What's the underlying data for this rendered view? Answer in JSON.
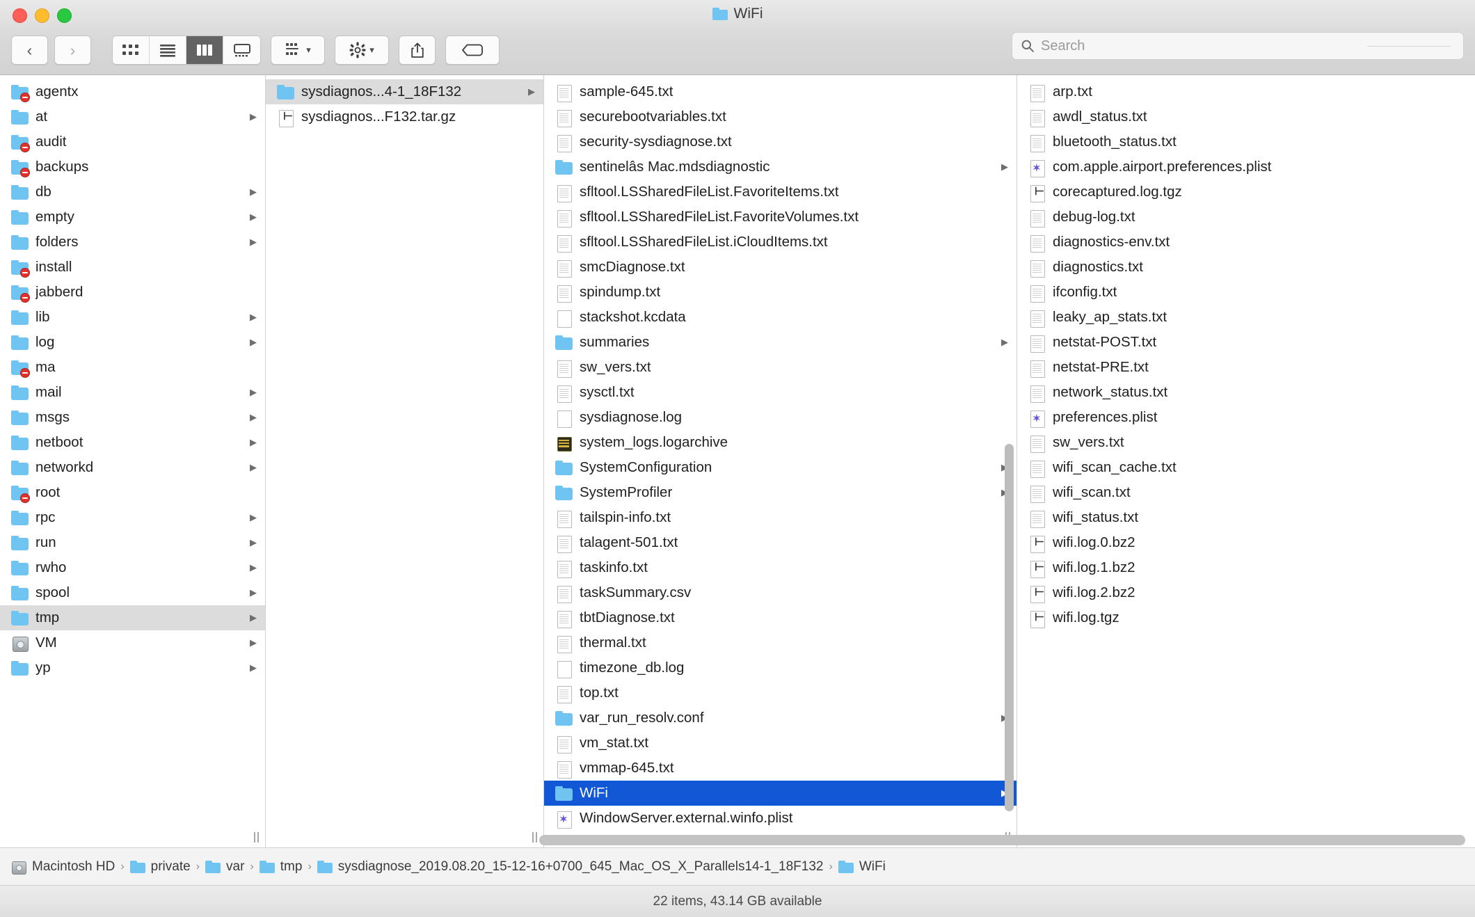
{
  "window": {
    "title": "WiFi",
    "title_icon": "folder-icon"
  },
  "toolbar": {
    "back_label": "‹",
    "forward_label": "›",
    "view_icons": [
      "icon-view-icon",
      "list-view-icon",
      "column-view-icon",
      "gallery-view-icon"
    ],
    "active_view": "column-view-icon",
    "group_label": "group-by-icon",
    "action_label": "gear-icon",
    "share_label": "share-icon",
    "tags_label": "tag-icon"
  },
  "search": {
    "placeholder": "Search",
    "value": ""
  },
  "columns": [
    {
      "name": "column-var",
      "items": [
        {
          "label": "agentx",
          "icon": "folder-icon",
          "badge": "no-access",
          "arrow": false
        },
        {
          "label": "at",
          "icon": "folder-icon",
          "arrow": true
        },
        {
          "label": "audit",
          "icon": "folder-icon",
          "badge": "no-access",
          "arrow": false
        },
        {
          "label": "backups",
          "icon": "folder-icon",
          "badge": "no-access",
          "arrow": false
        },
        {
          "label": "db",
          "icon": "folder-icon",
          "arrow": true
        },
        {
          "label": "empty",
          "icon": "folder-icon",
          "arrow": true
        },
        {
          "label": "folders",
          "icon": "folder-icon",
          "arrow": true
        },
        {
          "label": "install",
          "icon": "folder-icon",
          "badge": "no-access",
          "arrow": false
        },
        {
          "label": "jabberd",
          "icon": "folder-icon",
          "badge": "no-access",
          "arrow": false
        },
        {
          "label": "lib",
          "icon": "folder-icon",
          "arrow": true
        },
        {
          "label": "log",
          "icon": "folder-icon",
          "arrow": true
        },
        {
          "label": "ma",
          "icon": "folder-icon",
          "badge": "no-access",
          "arrow": false
        },
        {
          "label": "mail",
          "icon": "folder-icon",
          "arrow": true
        },
        {
          "label": "msgs",
          "icon": "folder-icon",
          "arrow": true
        },
        {
          "label": "netboot",
          "icon": "folder-icon",
          "arrow": true
        },
        {
          "label": "networkd",
          "icon": "folder-icon",
          "arrow": true
        },
        {
          "label": "root",
          "icon": "folder-icon",
          "badge": "no-access",
          "arrow": false
        },
        {
          "label": "rpc",
          "icon": "folder-icon",
          "arrow": true
        },
        {
          "label": "run",
          "icon": "folder-icon",
          "arrow": true
        },
        {
          "label": "rwho",
          "icon": "folder-icon",
          "arrow": true
        },
        {
          "label": "spool",
          "icon": "folder-icon",
          "arrow": true
        },
        {
          "label": "tmp",
          "icon": "folder-icon",
          "arrow": true,
          "selected": "gray"
        },
        {
          "label": "VM",
          "icon": "disk-icon",
          "arrow": true
        },
        {
          "label": "yp",
          "icon": "folder-icon",
          "arrow": true
        }
      ]
    },
    {
      "name": "column-tmp",
      "items": [
        {
          "label": "sysdiagnos...4-1_18F132",
          "icon": "folder-icon",
          "arrow": true,
          "selected": "gray"
        },
        {
          "label": "sysdiagnos...F132.tar.gz",
          "icon": "archive-icon",
          "arrow": false
        }
      ]
    },
    {
      "name": "column-sysdiagnose",
      "items": [
        {
          "label": "sample-645.txt",
          "icon": "text-document-icon",
          "arrow": false
        },
        {
          "label": "securebootvariables.txt",
          "icon": "text-document-icon",
          "arrow": false
        },
        {
          "label": "security-sysdiagnose.txt",
          "icon": "text-document-icon",
          "arrow": false
        },
        {
          "label": "sentinelâs Mac.mdsdiagnostic",
          "icon": "folder-icon",
          "arrow": true
        },
        {
          "label": "sfltool.LSSharedFileList.FavoriteItems.txt",
          "icon": "text-document-icon",
          "arrow": false
        },
        {
          "label": "sfltool.LSSharedFileList.FavoriteVolumes.txt",
          "icon": "text-document-icon",
          "arrow": false
        },
        {
          "label": "sfltool.LSSharedFileList.iCloudItems.txt",
          "icon": "text-document-icon",
          "arrow": false
        },
        {
          "label": "smcDiagnose.txt",
          "icon": "text-document-icon",
          "arrow": false
        },
        {
          "label": "spindump.txt",
          "icon": "text-document-icon",
          "arrow": false
        },
        {
          "label": "stackshot.kcdata",
          "icon": "blank-document-icon",
          "arrow": false
        },
        {
          "label": "summaries",
          "icon": "folder-icon",
          "arrow": true
        },
        {
          "label": "sw_vers.txt",
          "icon": "text-document-icon",
          "arrow": false
        },
        {
          "label": "sysctl.txt",
          "icon": "text-document-icon",
          "arrow": false
        },
        {
          "label": "sysdiagnose.log",
          "icon": "blank-document-icon",
          "arrow": false
        },
        {
          "label": "system_logs.logarchive",
          "icon": "log-archive-icon",
          "arrow": false
        },
        {
          "label": "SystemConfiguration",
          "icon": "folder-icon",
          "arrow": true
        },
        {
          "label": "SystemProfiler",
          "icon": "folder-icon",
          "arrow": true
        },
        {
          "label": "tailspin-info.txt",
          "icon": "text-document-icon",
          "arrow": false
        },
        {
          "label": "talagent-501.txt",
          "icon": "text-document-icon",
          "arrow": false
        },
        {
          "label": "taskinfo.txt",
          "icon": "text-document-icon",
          "arrow": false
        },
        {
          "label": "taskSummary.csv",
          "icon": "text-document-icon",
          "arrow": false
        },
        {
          "label": "tbtDiagnose.txt",
          "icon": "text-document-icon",
          "arrow": false
        },
        {
          "label": "thermal.txt",
          "icon": "text-document-icon",
          "arrow": false
        },
        {
          "label": "timezone_db.log",
          "icon": "blank-document-icon",
          "arrow": false
        },
        {
          "label": "top.txt",
          "icon": "text-document-icon",
          "arrow": false
        },
        {
          "label": "var_run_resolv.conf",
          "icon": "folder-icon",
          "arrow": true
        },
        {
          "label": "vm_stat.txt",
          "icon": "text-document-icon",
          "arrow": false
        },
        {
          "label": "vmmap-645.txt",
          "icon": "text-document-icon",
          "arrow": false
        },
        {
          "label": "WiFi",
          "icon": "folder-icon",
          "arrow": true,
          "selected": "blue"
        },
        {
          "label": "WindowServer.external.winfo.plist",
          "icon": "plist-icon",
          "arrow": false
        }
      ]
    },
    {
      "name": "column-wifi",
      "items": [
        {
          "label": "arp.txt",
          "icon": "text-document-icon",
          "arrow": false
        },
        {
          "label": "awdl_status.txt",
          "icon": "text-document-icon",
          "arrow": false
        },
        {
          "label": "bluetooth_status.txt",
          "icon": "text-document-icon",
          "arrow": false
        },
        {
          "label": "com.apple.airport.preferences.plist",
          "icon": "plist-icon",
          "arrow": false
        },
        {
          "label": "corecaptured.log.tgz",
          "icon": "archive-icon",
          "arrow": false
        },
        {
          "label": "debug-log.txt",
          "icon": "text-document-icon",
          "arrow": false
        },
        {
          "label": "diagnostics-env.txt",
          "icon": "text-document-icon",
          "arrow": false
        },
        {
          "label": "diagnostics.txt",
          "icon": "text-document-icon",
          "arrow": false
        },
        {
          "label": "ifconfig.txt",
          "icon": "text-document-icon",
          "arrow": false
        },
        {
          "label": "leaky_ap_stats.txt",
          "icon": "text-document-icon",
          "arrow": false
        },
        {
          "label": "netstat-POST.txt",
          "icon": "text-document-icon",
          "arrow": false
        },
        {
          "label": "netstat-PRE.txt",
          "icon": "text-document-icon",
          "arrow": false
        },
        {
          "label": "network_status.txt",
          "icon": "text-document-icon",
          "arrow": false
        },
        {
          "label": "preferences.plist",
          "icon": "plist-icon",
          "arrow": false
        },
        {
          "label": "sw_vers.txt",
          "icon": "text-document-icon",
          "arrow": false
        },
        {
          "label": "wifi_scan_cache.txt",
          "icon": "text-document-icon",
          "arrow": false
        },
        {
          "label": "wifi_scan.txt",
          "icon": "text-document-icon",
          "arrow": false
        },
        {
          "label": "wifi_status.txt",
          "icon": "text-document-icon",
          "arrow": false
        },
        {
          "label": "wifi.log.0.bz2",
          "icon": "archive-icon",
          "arrow": false
        },
        {
          "label": "wifi.log.1.bz2",
          "icon": "archive-icon",
          "arrow": false
        },
        {
          "label": "wifi.log.2.bz2",
          "icon": "archive-icon",
          "arrow": false
        },
        {
          "label": "wifi.log.tgz",
          "icon": "archive-icon",
          "arrow": false
        }
      ]
    }
  ],
  "pathbar": {
    "crumbs": [
      {
        "label": "Macintosh HD",
        "icon": "disk-icon"
      },
      {
        "label": "private",
        "icon": "folder-icon"
      },
      {
        "label": "var",
        "icon": "folder-icon"
      },
      {
        "label": "tmp",
        "icon": "folder-icon"
      },
      {
        "label": "sysdiagnose_2019.08.20_15-12-16+0700_645_Mac_OS_X_Parallels14-1_18F132",
        "icon": "folder-icon"
      },
      {
        "label": "WiFi",
        "icon": "folder-icon"
      }
    ],
    "separator": "›"
  },
  "statusbar": {
    "text": "22 items, 43.14 GB available"
  },
  "colors": {
    "selection_blue": "#1257d6",
    "selection_gray": "#dcdcdc",
    "folder_blue": "#6fc4f2",
    "plist_purple": "#6a4fd8"
  }
}
